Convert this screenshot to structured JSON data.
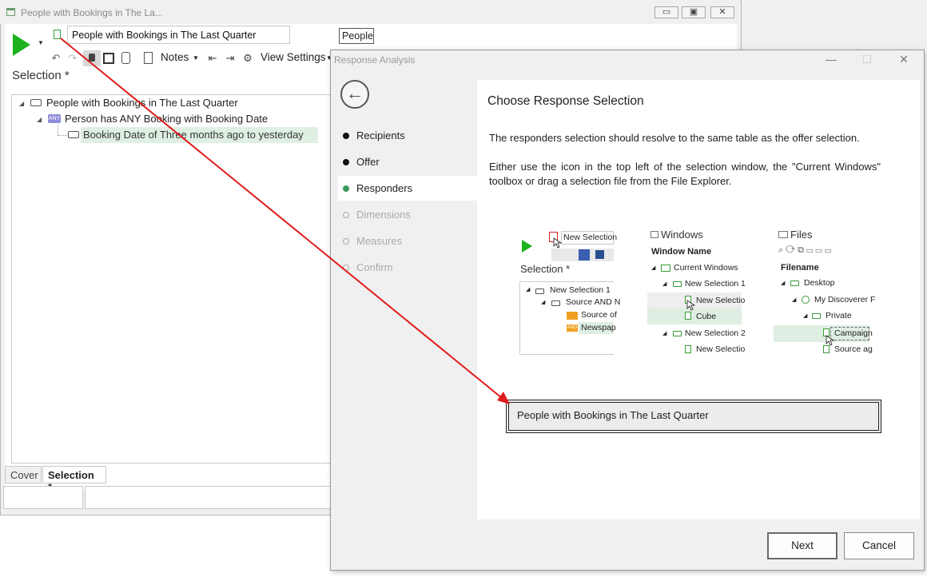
{
  "background_window": {
    "title": "People with Bookings in The La...",
    "controls": [
      "▭",
      "▣",
      "✕"
    ],
    "selection_name": "People with Bookings in The Last Quarter",
    "table_field": "People",
    "toolbar": {
      "notes_label": "Notes",
      "view_settings_label": "View Settings"
    },
    "heading": "Selection *",
    "tree": [
      "People with Bookings in The Last Quarter",
      "Person has ANY Booking with Booking Date",
      "Booking Date of Three months ago to yesterday"
    ],
    "any_badge": "ANY",
    "tabs": [
      "Cover",
      "Selection *"
    ]
  },
  "dialog": {
    "title": "Response Analysis",
    "steps": [
      {
        "label": "Recipients",
        "state": "done"
      },
      {
        "label": "Offer",
        "state": "done"
      },
      {
        "label": "Responders",
        "state": "active"
      },
      {
        "label": "Dimensions",
        "state": "pending"
      },
      {
        "label": "Measures",
        "state": "pending"
      },
      {
        "label": "Confirm",
        "state": "pending"
      }
    ],
    "heading": "Choose Response Selection",
    "paragraph1": "The responders selection should resolve to the same table as the offer selection.",
    "paragraph2": "Either use the icon in the top left of the selection window, the \"Current Windows\" toolbox or drag a selection file from the File Explorer.",
    "drop_value": "People with Bookings in The Last Quarter",
    "buttons": {
      "next": "Next",
      "cancel": "Cancel"
    }
  },
  "illustration": {
    "selection_panel": {
      "name_field": "New Selection",
      "heading": "Selection *",
      "tree": [
        "New Selection 1",
        "Source AND N",
        "Source of",
        "Newspap"
      ],
      "and_badge": "AND"
    },
    "windows_panel": {
      "header": "Windows",
      "column": "Window Name",
      "items": [
        "Current Windows",
        "New Selection 1",
        "New Selectio",
        "Cube",
        "New Selection 2",
        "New Selectio"
      ]
    },
    "files_panel": {
      "header": "Files",
      "column": "Filename",
      "items": [
        "Desktop",
        "My Discoverer F",
        "Private",
        "Campaign",
        "Source ag"
      ]
    }
  },
  "colors": {
    "play_green": "#1db21d",
    "arrow_red": "#e01b1b",
    "highlight_green": "#dff0e2",
    "step_active": "#3a9a5a"
  }
}
